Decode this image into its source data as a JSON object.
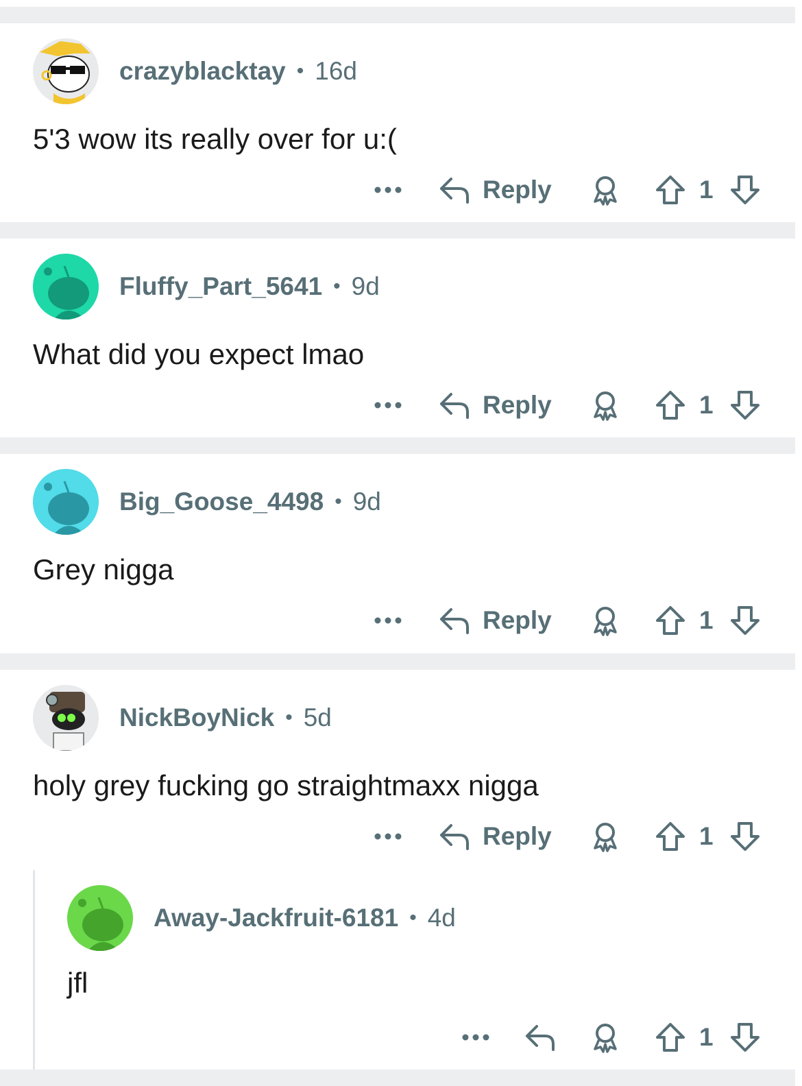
{
  "comments": [
    {
      "author": "crazyblacktay",
      "age": "16d",
      "text": "5'3 wow its really over for u:(",
      "reply_label": "Reply",
      "votes": "1",
      "avatar_bg": "#e8eaec"
    },
    {
      "author": "Fluffy_Part_5641",
      "age": "9d",
      "text": "What did you expect lmao",
      "reply_label": "Reply",
      "votes": "1",
      "avatar_bg": "#1ed8a8"
    },
    {
      "author": "Big_Goose_4498",
      "age": "9d",
      "text": "Grey nigga",
      "reply_label": "Reply",
      "votes": "1",
      "avatar_bg": "#52dbe8"
    },
    {
      "author": "NickBoyNick",
      "age": "5d",
      "text": "holy grey fucking go straightmaxx nigga",
      "reply_label": "Reply",
      "votes": "1",
      "avatar_bg": "#e8eaec"
    },
    {
      "author": "Away-Jackfruit-6181",
      "age": "4d",
      "text": "jfl",
      "votes": "1",
      "avatar_bg": "#6bd84a"
    }
  ],
  "meta_separator": "•",
  "colors": {
    "text": "#1a1a1b",
    "meta": "#576f76",
    "separator_band": "#eceef0"
  },
  "icons": [
    "more-icon",
    "reply-icon",
    "award-icon",
    "upvote-icon",
    "downvote-icon"
  ]
}
